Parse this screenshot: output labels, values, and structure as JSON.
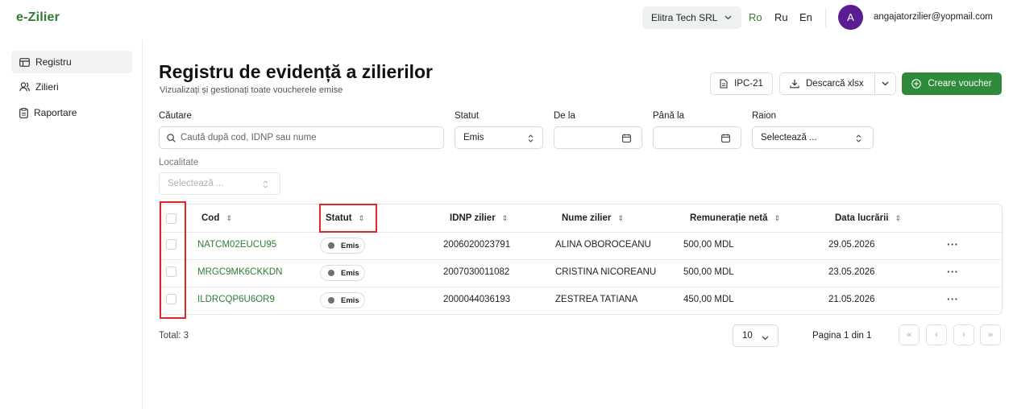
{
  "app": {
    "logo": "e-Zilier"
  },
  "topbar": {
    "company": "Elitra Tech SRL",
    "languages": [
      "Ro",
      "Ru",
      "En"
    ],
    "active_language": "Ro",
    "avatar_letter": "A",
    "email": "angajatorzilier@yopmail.com"
  },
  "sidebar": {
    "items": [
      {
        "label": "Registru",
        "icon": "register-icon",
        "active": true
      },
      {
        "label": "Zilieri",
        "icon": "users-icon",
        "active": false
      },
      {
        "label": "Raportare",
        "icon": "report-icon",
        "active": false
      }
    ]
  },
  "header": {
    "title": "Registru de evidență a zilierilor",
    "subtitle": "Vizualizați și gestionați toate voucherele emise",
    "ipc_label": "IPC-21",
    "download_label": "Descarcă xlsx",
    "create_label": "Creare voucher"
  },
  "filters": {
    "search_label": "Căutare",
    "search_placeholder": "Caută după cod, IDNP sau nume",
    "status_label": "Statut",
    "status_value": "Emis",
    "from_label": "De la",
    "to_label": "Până la",
    "raion_label": "Raion",
    "raion_placeholder": "Selectează ...",
    "localitate_label": "Localitate",
    "localitate_placeholder": "Selectează ..."
  },
  "table": {
    "columns": [
      "Cod",
      "Statut",
      "IDNP zilier",
      "Nume zilier",
      "Remunerație netă",
      "Data lucrării"
    ],
    "rows": [
      {
        "cod": "NATCM02EUCU95",
        "statut": "Emis",
        "idnp": "2006020023791",
        "nume": "ALINA OBOROCEANU",
        "remuneratie": "500,00 MDL",
        "data": "29.05.2026"
      },
      {
        "cod": "MRGC9MK6CKKDN",
        "statut": "Emis",
        "idnp": "2007030011082",
        "nume": "CRISTINA NICOREANU",
        "remuneratie": "500,00 MDL",
        "data": "23.05.2026"
      },
      {
        "cod": "ILDRCQP6U6OR9",
        "statut": "Emis",
        "idnp": "2000044036193",
        "nume": "ZESTREA TATIANA",
        "remuneratie": "450,00 MDL",
        "data": "21.05.2026"
      }
    ],
    "row_actions": "···"
  },
  "footer": {
    "total": "Total: 3",
    "page_size": "10",
    "page_info": "Pagina 1 din 1",
    "pager": [
      "«",
      "‹",
      "›",
      "»"
    ]
  },
  "colors": {
    "brand_green": "#2f7d32",
    "button_green": "#2f8a3b",
    "avatar_purple": "#5b1d92",
    "highlight_red": "#e0262a"
  }
}
